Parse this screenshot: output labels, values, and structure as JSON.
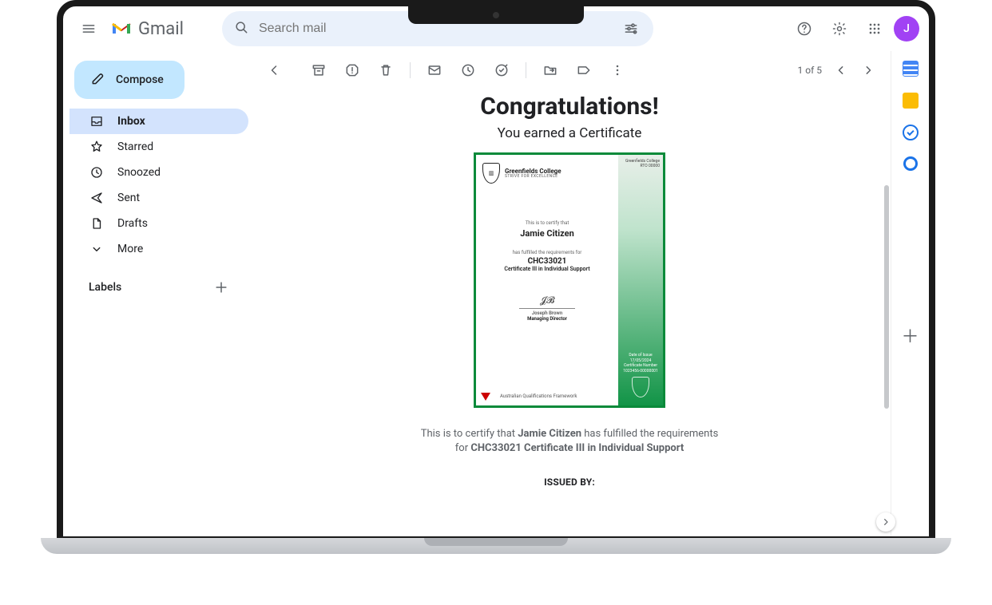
{
  "header": {
    "brand": "Gmail",
    "search_placeholder": "Search mail",
    "avatar_initial": "J"
  },
  "compose_label": "Compose",
  "nav": [
    {
      "icon": "inbox",
      "label": "Inbox",
      "active": true
    },
    {
      "icon": "star",
      "label": "Starred"
    },
    {
      "icon": "clock",
      "label": "Snoozed"
    },
    {
      "icon": "send",
      "label": "Sent"
    },
    {
      "icon": "draft",
      "label": "Drafts"
    },
    {
      "icon": "more",
      "label": "More"
    }
  ],
  "labels_heading": "Labels",
  "pager": {
    "text": "1 of 5"
  },
  "email": {
    "title": "Congratulations!",
    "subtitle": "You earned a Certificate",
    "certificate": {
      "institution": "Greenfields College",
      "tagline": "STRIVE FOR EXCELLENCE",
      "rto_note": "Greenfields College RTO 00000",
      "certify_lead": "This is to certify that",
      "student": "Jamie Citizen",
      "fulfilled_lead": "has fulfilled the requirements for",
      "code": "CHC33021",
      "course": "Certificate III in Individual Support",
      "signatory_name": "Joseph Brown",
      "signatory_role": "Managing Director",
      "aqf_label": "Australian Qualifications Framework",
      "side_meta": "Date of Issue\n17/05/2024\nCertificate Number\n1023456-00000001"
    },
    "body_line1_pre": "This is to certify that ",
    "body_line1_name": "Jamie Citizen",
    "body_line1_post": " has fulfilled the requirements",
    "body_line2_pre": "for ",
    "body_line2_bold": "CHC33021 Certificate III in Individual Support",
    "issued_by_label": "ISSUED BY:"
  }
}
